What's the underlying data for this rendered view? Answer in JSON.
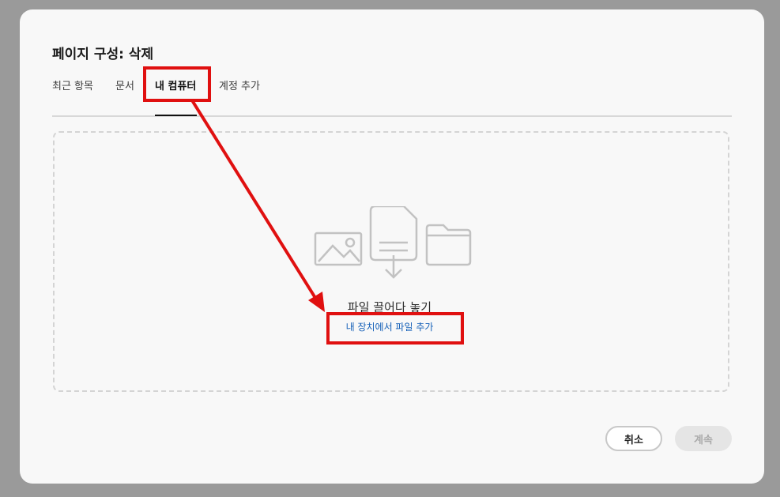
{
  "dialog": {
    "title": "페이지 구성: 삭제",
    "tabs": [
      {
        "label": "최근 항목",
        "active": false
      },
      {
        "label": "문서",
        "active": false
      },
      {
        "label": "내 컴퓨터",
        "active": true
      },
      {
        "label": "계정 추가",
        "active": false
      }
    ],
    "dropzone": {
      "title": "파일 끌어다 놓기",
      "link": "내 장치에서 파일 추가",
      "icons": [
        "image-icon",
        "file-download-icon",
        "folder-icon"
      ]
    },
    "buttons": {
      "cancel": "취소",
      "continue": "계속",
      "continue_disabled": true
    }
  },
  "annotation": {
    "color": "#e01010",
    "icons": [
      "highlight-box",
      "arrow-icon"
    ]
  }
}
